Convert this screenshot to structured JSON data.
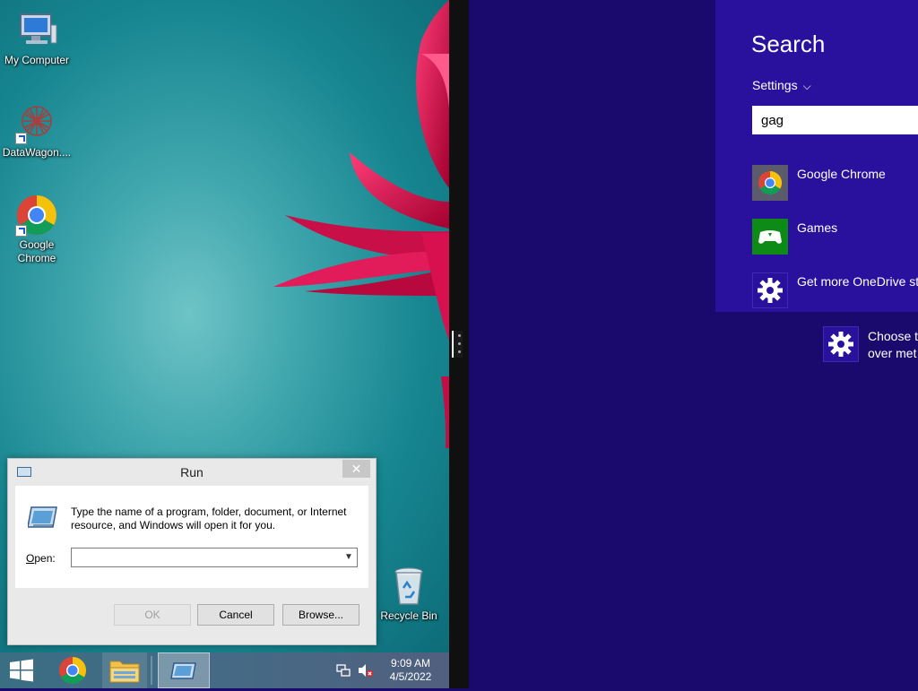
{
  "desktop": {
    "icons": [
      {
        "label": "My Computer",
        "icon": "computer-icon"
      },
      {
        "label": "DataWagon....",
        "icon": "datawagon-icon"
      },
      {
        "label": "Google Chrome",
        "icon": "chrome-icon"
      },
      {
        "label": "Recycle Bin",
        "icon": "recycle-bin-icon"
      }
    ]
  },
  "run_dialog": {
    "title": "Run",
    "close_glyph": "✕",
    "message": "Type the name of a program, folder, document, or Internet resource, and Windows will open it for you.",
    "open_label_accel": "O",
    "open_label_rest": "pen:",
    "open_value": "",
    "buttons": {
      "ok": "OK",
      "cancel": "Cancel",
      "browse": "Browse..."
    }
  },
  "taskbar": {
    "clock_time": "9:09 AM",
    "clock_date": "4/5/2022",
    "items": [
      "start-button",
      "chrome-icon",
      "file-explorer-icon",
      "run-icon"
    ]
  },
  "search_charm": {
    "heading": "Search",
    "scope": "Settings",
    "query": "gag",
    "results": [
      {
        "label": "Google Chrome",
        "icon": "chrome-icon",
        "color": "#5b5b6b"
      },
      {
        "label": "Games",
        "icon": "gamepad-icon",
        "color": "#0e8a16"
      },
      {
        "label": "Get more OneDrive st",
        "icon": "gear-icon",
        "color": "#2a119d"
      }
    ],
    "suggestion": {
      "label": "Choose t\nover met",
      "icon": "gear-icon"
    }
  },
  "colors": {
    "start_background": "#1b0a6e",
    "search_panel": "#2a119d",
    "desktop_teal": "#16858f",
    "flower": "#d8104f"
  }
}
